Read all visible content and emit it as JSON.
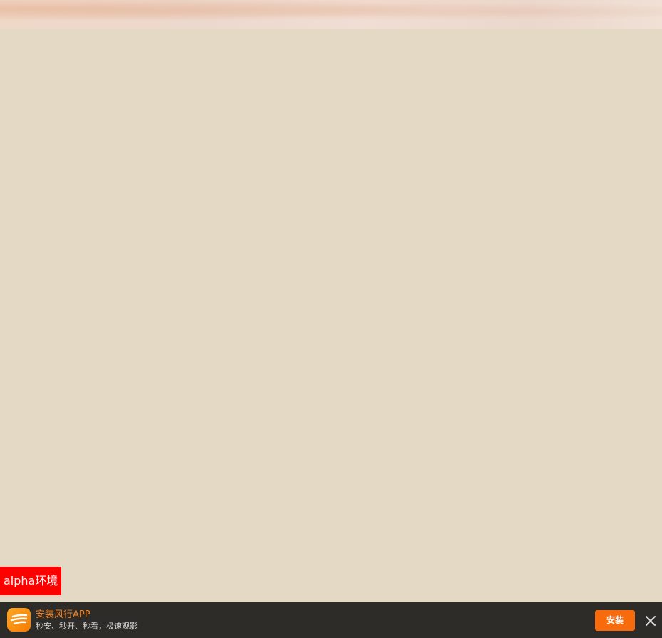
{
  "environment_badge": {
    "label": "alpha环境",
    "color": "#ff0000"
  },
  "app_banner": {
    "title": "安装风行APP",
    "subtitle": "秒安、秒开、秒看，极速观影",
    "install_label": "安装",
    "logo_icon": "funshion-app-logo-icon",
    "close_icon": "close-icon",
    "accent_color": "#f86b0c",
    "background_color": "#2d2c28"
  },
  "colors": {
    "page_background": "#e3d9c4",
    "header_tint": "#f0dcd0"
  }
}
